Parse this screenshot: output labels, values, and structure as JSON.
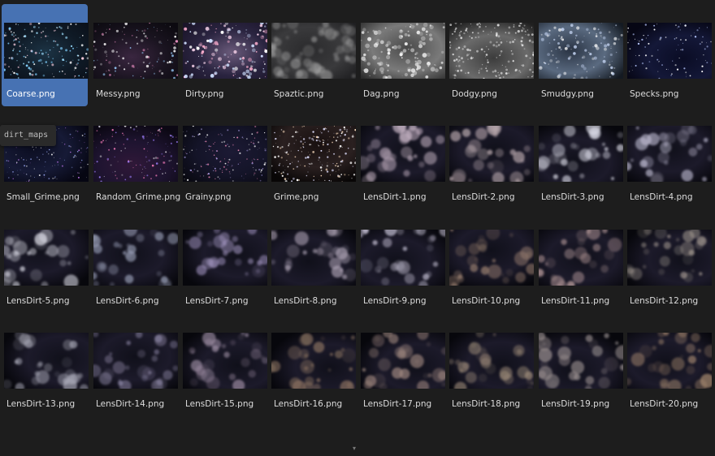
{
  "browser": {
    "selected_index": 0,
    "tooltip": "dirt_maps",
    "scroll_indicator": "▾",
    "files": [
      {
        "name": "Coarse.png",
        "type": "coarse"
      },
      {
        "name": "Messy.png",
        "type": "messy"
      },
      {
        "name": "Dirty.png",
        "type": "dirty"
      },
      {
        "name": "Spaztic.png",
        "type": "spaztic"
      },
      {
        "name": "Dag.png",
        "type": "dag"
      },
      {
        "name": "Dodgy.png",
        "type": "dodgy"
      },
      {
        "name": "Smudgy.png",
        "type": "smudgy"
      },
      {
        "name": "Specks.png",
        "type": "specks"
      },
      {
        "name": "Small_Grime.png",
        "type": "smallgrime"
      },
      {
        "name": "Random_Grime.png",
        "type": "randomgrime"
      },
      {
        "name": "Grainy.png",
        "type": "grainy"
      },
      {
        "name": "Grime.png",
        "type": "grime"
      },
      {
        "name": "LensDirt-1.png",
        "type": "lensdirt",
        "tint": "#cbb8c9"
      },
      {
        "name": "LensDirt-2.png",
        "type": "lensdirt",
        "tint": "#c5b3b8"
      },
      {
        "name": "LensDirt-3.png",
        "type": "lensdirt",
        "tint": "#d9d9e5"
      },
      {
        "name": "LensDirt-4.png",
        "type": "lensdirt",
        "tint": "#bdbad0"
      },
      {
        "name": "LensDirt-5.png",
        "type": "lensdirt",
        "tint": "#e5e5f0"
      },
      {
        "name": "LensDirt-6.png",
        "type": "lensdirt",
        "tint": "#9aa0b8"
      },
      {
        "name": "LensDirt-7.png",
        "type": "lensdirt",
        "tint": "#9b8fb8"
      },
      {
        "name": "LensDirt-8.png",
        "type": "lensdirt",
        "tint": "#b1a6b8"
      },
      {
        "name": "LensDirt-9.png",
        "type": "lensdirt",
        "tint": "#c9c4d8"
      },
      {
        "name": "LensDirt-10.png",
        "type": "lensdirt",
        "tint": "#9a8070"
      },
      {
        "name": "LensDirt-11.png",
        "type": "lensdirt",
        "tint": "#a88e90"
      },
      {
        "name": "LensDirt-12.png",
        "type": "lensdirt",
        "tint": "#a49a92"
      },
      {
        "name": "LensDirt-13.png",
        "type": "lensdirt",
        "tint": "#a6a6b4"
      },
      {
        "name": "LensDirt-14.png",
        "type": "lensdirt",
        "tint": "#8f88a8"
      },
      {
        "name": "LensDirt-15.png",
        "type": "lensdirt",
        "tint": "#9a8aa0"
      },
      {
        "name": "LensDirt-16.png",
        "type": "lensdirt",
        "tint": "#8a7260"
      },
      {
        "name": "LensDirt-17.png",
        "type": "lensdirt",
        "tint": "#a08880"
      },
      {
        "name": "LensDirt-18.png",
        "type": "lensdirt",
        "tint": "#9c8a78"
      },
      {
        "name": "LensDirt-19.png",
        "type": "lensdirt",
        "tint": "#9a9090"
      },
      {
        "name": "LensDirt-20.png",
        "type": "lensdirt",
        "tint": "#a88a70"
      }
    ]
  }
}
